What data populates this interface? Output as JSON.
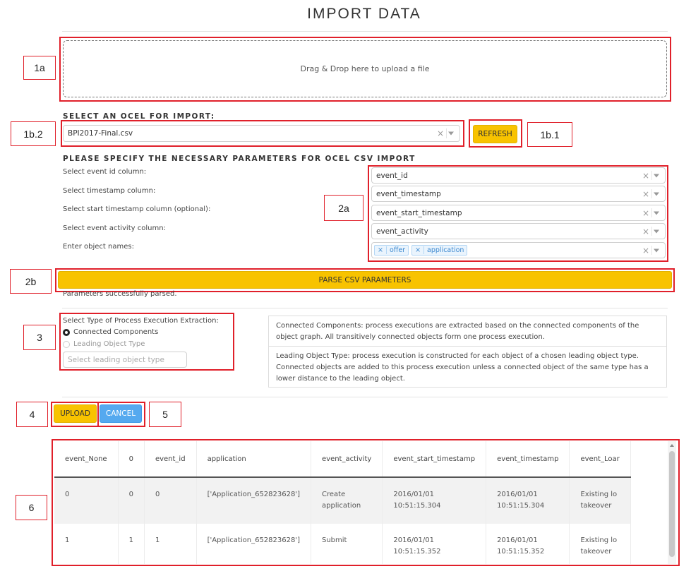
{
  "page": {
    "title": "IMPORT DATA"
  },
  "upload": {
    "dropzone_text": "Drag & Drop here to upload a file"
  },
  "ocel_select": {
    "label": "SELECT AN OCEL FOR IMPORT:",
    "value": "BPI2017-Final.csv",
    "refresh_label": "REFRESH"
  },
  "params": {
    "label": "PLEASE SPECIFY THE NECESSARY PARAMETERS FOR OCEL CSV IMPORT",
    "rows": [
      {
        "label": "Select event id column:",
        "value": "event_id"
      },
      {
        "label": "Select timestamp column:",
        "value": "event_timestamp"
      },
      {
        "label": "Select start timestamp column (optional):",
        "value": "event_start_timestamp"
      },
      {
        "label": "Select event activity column:",
        "value": "event_activity"
      },
      {
        "label": "Enter object names:",
        "tags": [
          "offer",
          "application"
        ]
      }
    ],
    "parse_label": "PARSE CSV PARAMETERS",
    "status": "Parameters successfully parsed."
  },
  "extraction": {
    "label": "Select Type of Process Execution Extraction:",
    "options": [
      "Connected Components",
      "Leading Object Type"
    ],
    "selected": "Connected Components",
    "leading_placeholder": "Select leading object type",
    "info": [
      "Connected Components: process executions are extracted based on the connected components of the object graph. All transitively connected objects form one process execution.",
      "Leading Object Type: process execution is constructed for each object of a chosen leading object type. Connected objects are added to this process execution unless a connected object of the same type has a lower distance to the leading object."
    ]
  },
  "actions": {
    "upload_label": "UPLOAD",
    "cancel_label": "CANCEL"
  },
  "table": {
    "columns": [
      "event_None",
      "0",
      "event_id",
      "application",
      "event_activity",
      "event_start_timestamp",
      "event_timestamp",
      "event_Loar"
    ],
    "rows": [
      [
        "0",
        "0",
        "0",
        "['Application_652823628']",
        "Create\napplication",
        "2016/01/01\n10:51:15.304",
        "2016/01/01\n10:51:15.304",
        "Existing lo\ntakeover"
      ],
      [
        "1",
        "1",
        "1",
        "['Application_652823628']",
        "Submit",
        "2016/01/01\n10:51:15.352",
        "2016/01/01\n10:51:15.352",
        "Existing lo\ntakeover"
      ]
    ]
  },
  "annotations": {
    "1a": "1a",
    "1b2": "1b.2",
    "1b1": "1b.1",
    "2a": "2a",
    "2b": "2b",
    "3": "3",
    "4": "4",
    "5": "5",
    "6": "6"
  },
  "colors": {
    "annotation": "#e0202a",
    "primary": "#f8c300",
    "secondary": "#55a9ef"
  }
}
